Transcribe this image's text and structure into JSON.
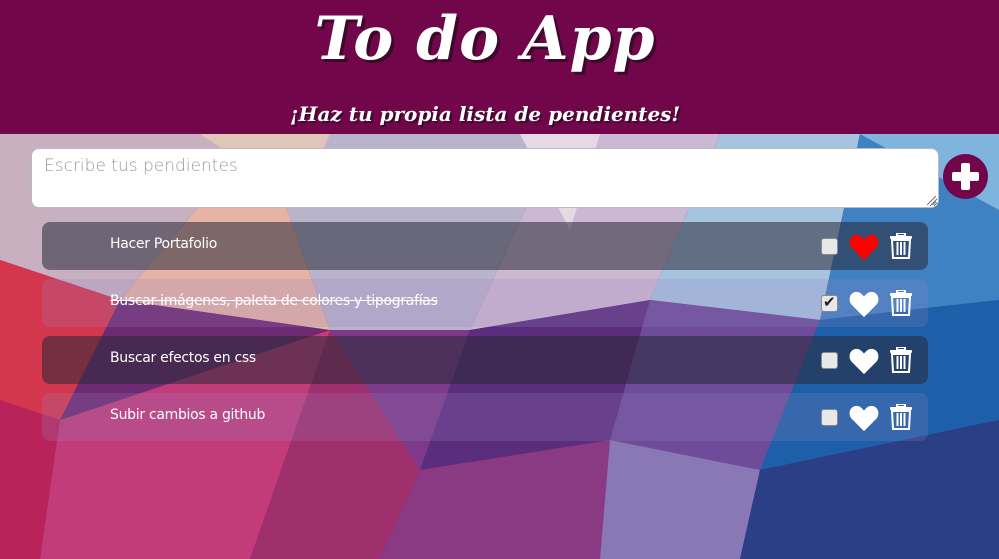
{
  "header": {
    "title": "To do App",
    "subtitle": "¡Haz tu propia lista de pendientes!"
  },
  "input": {
    "placeholder": "Escribe tus pendientes",
    "value": ""
  },
  "add_button": {
    "icon": "plus-icon"
  },
  "todos": [
    {
      "text": "Hacer Portafolio",
      "completed": false,
      "favorite": true
    },
    {
      "text": "Buscar imágenes, paleta de colores y tipografías",
      "completed": true,
      "favorite": false
    },
    {
      "text": "Buscar efectos en css",
      "completed": false,
      "favorite": false
    },
    {
      "text": "Subir cambios a github",
      "completed": false,
      "favorite": false
    }
  ],
  "colors": {
    "header": "#72064a",
    "favorite_heart": "#ff0000",
    "heart": "#ffffff"
  }
}
